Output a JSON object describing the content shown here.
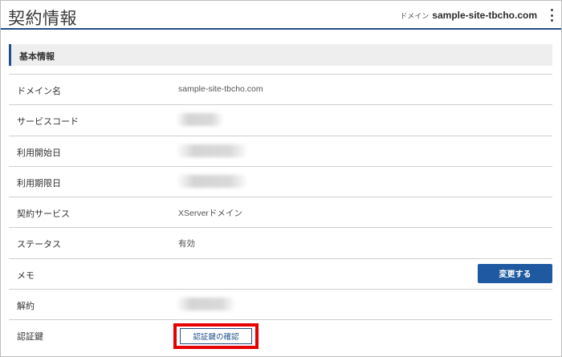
{
  "header": {
    "title": "契約情報",
    "domain_label": "ドメイン",
    "domain_value": "sample-site-tbcho.com",
    "menu_icon": "kebab-menu-icon"
  },
  "section": {
    "title": "基本情報"
  },
  "rows": [
    {
      "label": "ドメイン名",
      "value": "sample-site-tbcho.com"
    },
    {
      "label": "サービスコード",
      "value": ""
    },
    {
      "label": "利用開始日",
      "value": ""
    },
    {
      "label": "利用期限日",
      "value": ""
    },
    {
      "label": "契約サービス",
      "value": "XServerドメイン"
    },
    {
      "label": "ステータス",
      "value": "有効"
    },
    {
      "label": "メモ",
      "value": "",
      "button": "変更する"
    },
    {
      "label": "解約",
      "value": ""
    },
    {
      "label": "認証鍵",
      "value": "",
      "button": "認証鍵の確認"
    }
  ],
  "colors": {
    "accent": "#1f4f8a",
    "button": "#1f5aa0",
    "highlight": "#e60000",
    "section_bg": "#eeeeee"
  }
}
